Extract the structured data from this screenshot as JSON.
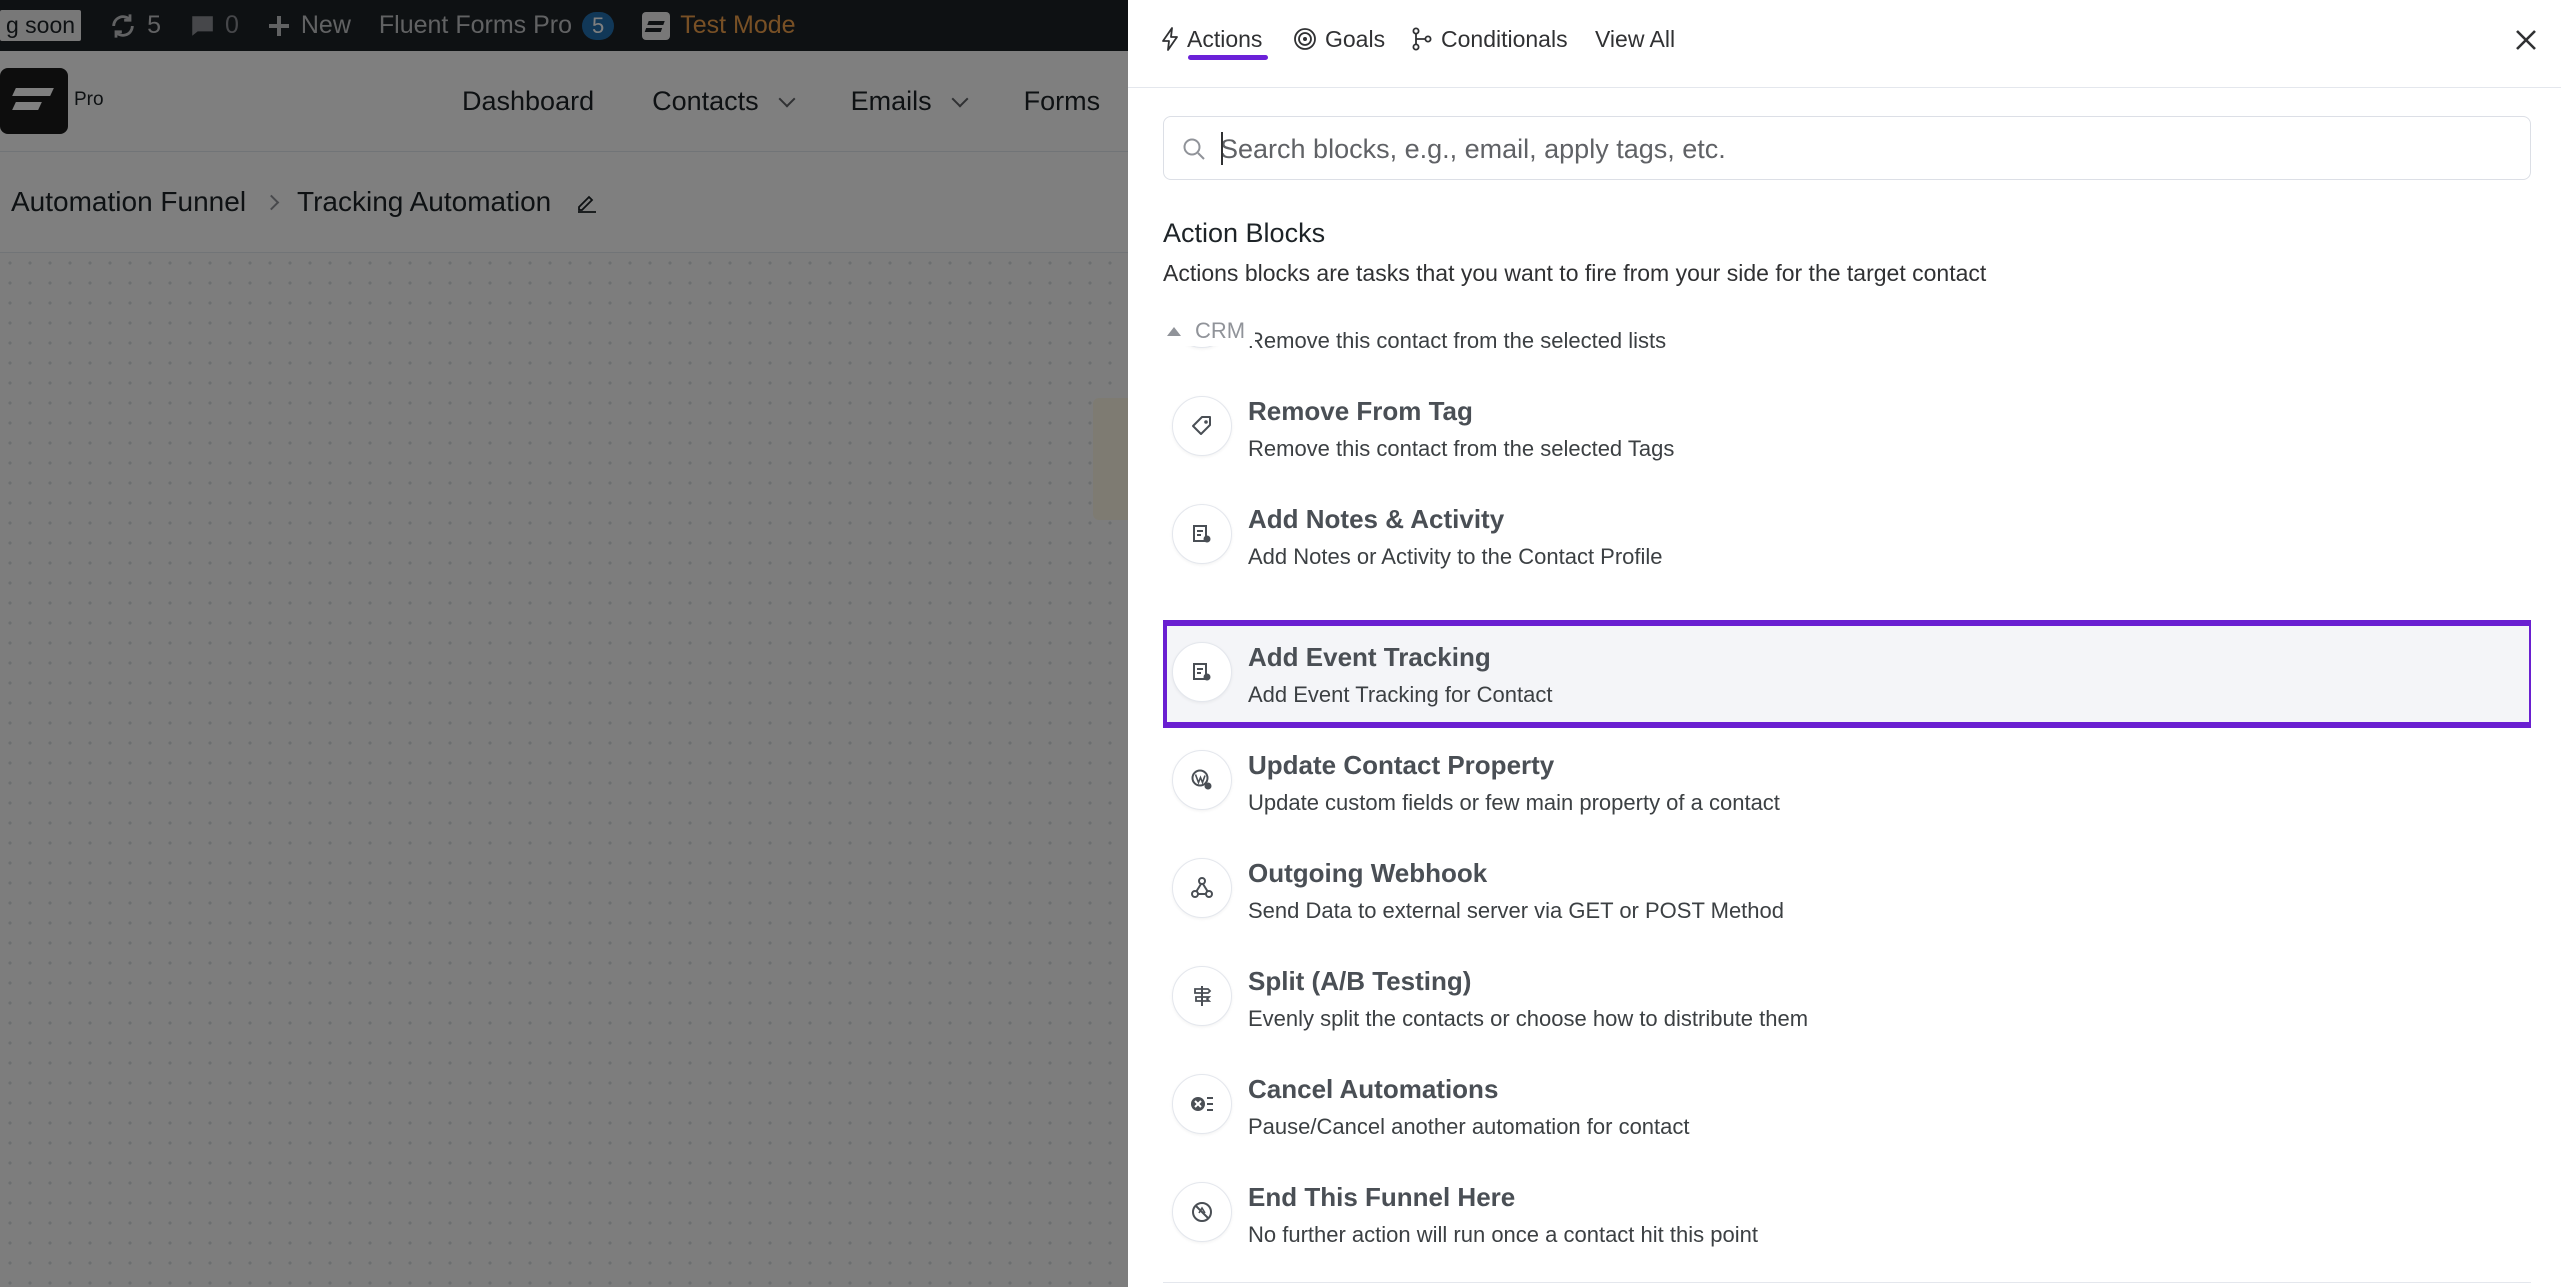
{
  "adminbar": {
    "coming_soon": "g soon",
    "updates_count": "5",
    "comments_count": "0",
    "new_label": "New",
    "plugin_label": "Fluent Forms Pro",
    "plugin_badge": "5",
    "test_mode_label": "Test Mode"
  },
  "app": {
    "logo_suffix": "Pro",
    "nav": [
      {
        "label": "Dashboard"
      },
      {
        "label": "Contacts"
      },
      {
        "label": "Emails"
      },
      {
        "label": "Forms"
      }
    ]
  },
  "breadcrumb": {
    "parent": "Automation Funnel",
    "current": "Tracking Automation"
  },
  "drawer": {
    "tabs": [
      {
        "label": "Actions",
        "icon": "lightning-icon",
        "active": true
      },
      {
        "label": "Goals",
        "icon": "target-icon"
      },
      {
        "label": "Conditionals",
        "icon": "branch-icon"
      },
      {
        "label": "View All"
      }
    ],
    "search_placeholder": "Search blocks, e.g., email, apply tags, etc.",
    "section_title": "Action Blocks",
    "section_subtitle": "Actions blocks are tasks that you want to fire from your side for the target contact",
    "group_label": "CRM",
    "items": [
      {
        "title": "",
        "desc": "Remove this contact from the selected lists",
        "icon": "list-remove-icon"
      },
      {
        "title": "Remove From Tag",
        "desc": "Remove this contact from the selected Tags",
        "icon": "tag-icon"
      },
      {
        "title": "Add Notes & Activity",
        "desc": "Add Notes or Activity to the Contact Profile",
        "icon": "note-icon"
      },
      {
        "title": "Add Event Tracking",
        "desc": "Add Event Tracking for Contact",
        "icon": "event-icon",
        "highlighted": true
      },
      {
        "title": "Update Contact Property",
        "desc": "Update custom fields or few main property of a contact",
        "icon": "wordpress-icon"
      },
      {
        "title": "Outgoing Webhook",
        "desc": "Send Data to external server via GET or POST Method",
        "icon": "webhook-icon"
      },
      {
        "title": "Split (A/B Testing)",
        "desc": "Evenly split the contacts or choose how to distribute them",
        "icon": "split-icon"
      },
      {
        "title": "Cancel Automations",
        "desc": "Pause/Cancel another automation for contact",
        "icon": "cancel-icon"
      },
      {
        "title": "End This Funnel Here",
        "desc": "No further action will run once a contact hit this point",
        "icon": "stop-icon"
      }
    ]
  },
  "colors": {
    "accent": "#6a1fd1",
    "adminbar_bg": "#1d2327",
    "test_mode": "#f0a04b"
  }
}
